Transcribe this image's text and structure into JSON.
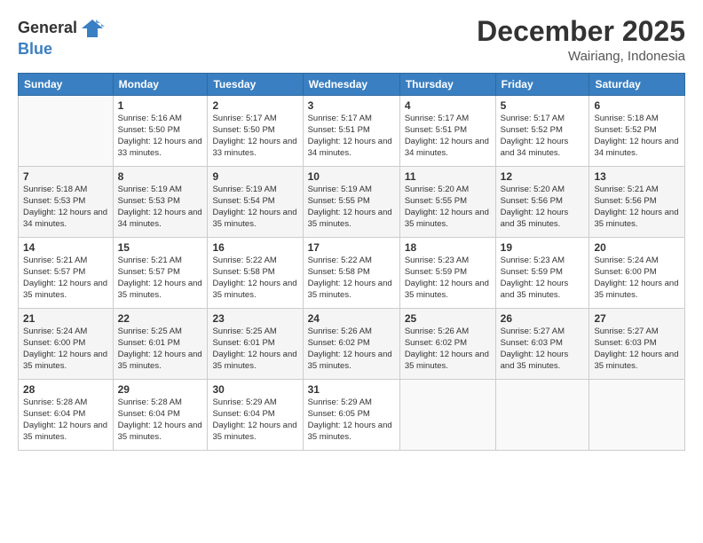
{
  "app": {
    "logo_general": "General",
    "logo_blue": "Blue"
  },
  "header": {
    "month": "December 2025",
    "location": "Wairiang, Indonesia"
  },
  "columns": [
    "Sunday",
    "Monday",
    "Tuesday",
    "Wednesday",
    "Thursday",
    "Friday",
    "Saturday"
  ],
  "weeks": [
    [
      {
        "day": "",
        "sunrise": "",
        "sunset": "",
        "daylight": ""
      },
      {
        "day": "1",
        "sunrise": "Sunrise: 5:16 AM",
        "sunset": "Sunset: 5:50 PM",
        "daylight": "Daylight: 12 hours and 33 minutes."
      },
      {
        "day": "2",
        "sunrise": "Sunrise: 5:17 AM",
        "sunset": "Sunset: 5:50 PM",
        "daylight": "Daylight: 12 hours and 33 minutes."
      },
      {
        "day": "3",
        "sunrise": "Sunrise: 5:17 AM",
        "sunset": "Sunset: 5:51 PM",
        "daylight": "Daylight: 12 hours and 34 minutes."
      },
      {
        "day": "4",
        "sunrise": "Sunrise: 5:17 AM",
        "sunset": "Sunset: 5:51 PM",
        "daylight": "Daylight: 12 hours and 34 minutes."
      },
      {
        "day": "5",
        "sunrise": "Sunrise: 5:17 AM",
        "sunset": "Sunset: 5:52 PM",
        "daylight": "Daylight: 12 hours and 34 minutes."
      },
      {
        "day": "6",
        "sunrise": "Sunrise: 5:18 AM",
        "sunset": "Sunset: 5:52 PM",
        "daylight": "Daylight: 12 hours and 34 minutes."
      }
    ],
    [
      {
        "day": "7",
        "sunrise": "Sunrise: 5:18 AM",
        "sunset": "Sunset: 5:53 PM",
        "daylight": "Daylight: 12 hours and 34 minutes."
      },
      {
        "day": "8",
        "sunrise": "Sunrise: 5:19 AM",
        "sunset": "Sunset: 5:53 PM",
        "daylight": "Daylight: 12 hours and 34 minutes."
      },
      {
        "day": "9",
        "sunrise": "Sunrise: 5:19 AM",
        "sunset": "Sunset: 5:54 PM",
        "daylight": "Daylight: 12 hours and 35 minutes."
      },
      {
        "day": "10",
        "sunrise": "Sunrise: 5:19 AM",
        "sunset": "Sunset: 5:55 PM",
        "daylight": "Daylight: 12 hours and 35 minutes."
      },
      {
        "day": "11",
        "sunrise": "Sunrise: 5:20 AM",
        "sunset": "Sunset: 5:55 PM",
        "daylight": "Daylight: 12 hours and 35 minutes."
      },
      {
        "day": "12",
        "sunrise": "Sunrise: 5:20 AM",
        "sunset": "Sunset: 5:56 PM",
        "daylight": "Daylight: 12 hours and 35 minutes."
      },
      {
        "day": "13",
        "sunrise": "Sunrise: 5:21 AM",
        "sunset": "Sunset: 5:56 PM",
        "daylight": "Daylight: 12 hours and 35 minutes."
      }
    ],
    [
      {
        "day": "14",
        "sunrise": "Sunrise: 5:21 AM",
        "sunset": "Sunset: 5:57 PM",
        "daylight": "Daylight: 12 hours and 35 minutes."
      },
      {
        "day": "15",
        "sunrise": "Sunrise: 5:21 AM",
        "sunset": "Sunset: 5:57 PM",
        "daylight": "Daylight: 12 hours and 35 minutes."
      },
      {
        "day": "16",
        "sunrise": "Sunrise: 5:22 AM",
        "sunset": "Sunset: 5:58 PM",
        "daylight": "Daylight: 12 hours and 35 minutes."
      },
      {
        "day": "17",
        "sunrise": "Sunrise: 5:22 AM",
        "sunset": "Sunset: 5:58 PM",
        "daylight": "Daylight: 12 hours and 35 minutes."
      },
      {
        "day": "18",
        "sunrise": "Sunrise: 5:23 AM",
        "sunset": "Sunset: 5:59 PM",
        "daylight": "Daylight: 12 hours and 35 minutes."
      },
      {
        "day": "19",
        "sunrise": "Sunrise: 5:23 AM",
        "sunset": "Sunset: 5:59 PM",
        "daylight": "Daylight: 12 hours and 35 minutes."
      },
      {
        "day": "20",
        "sunrise": "Sunrise: 5:24 AM",
        "sunset": "Sunset: 6:00 PM",
        "daylight": "Daylight: 12 hours and 35 minutes."
      }
    ],
    [
      {
        "day": "21",
        "sunrise": "Sunrise: 5:24 AM",
        "sunset": "Sunset: 6:00 PM",
        "daylight": "Daylight: 12 hours and 35 minutes."
      },
      {
        "day": "22",
        "sunrise": "Sunrise: 5:25 AM",
        "sunset": "Sunset: 6:01 PM",
        "daylight": "Daylight: 12 hours and 35 minutes."
      },
      {
        "day": "23",
        "sunrise": "Sunrise: 5:25 AM",
        "sunset": "Sunset: 6:01 PM",
        "daylight": "Daylight: 12 hours and 35 minutes."
      },
      {
        "day": "24",
        "sunrise": "Sunrise: 5:26 AM",
        "sunset": "Sunset: 6:02 PM",
        "daylight": "Daylight: 12 hours and 35 minutes."
      },
      {
        "day": "25",
        "sunrise": "Sunrise: 5:26 AM",
        "sunset": "Sunset: 6:02 PM",
        "daylight": "Daylight: 12 hours and 35 minutes."
      },
      {
        "day": "26",
        "sunrise": "Sunrise: 5:27 AM",
        "sunset": "Sunset: 6:03 PM",
        "daylight": "Daylight: 12 hours and 35 minutes."
      },
      {
        "day": "27",
        "sunrise": "Sunrise: 5:27 AM",
        "sunset": "Sunset: 6:03 PM",
        "daylight": "Daylight: 12 hours and 35 minutes."
      }
    ],
    [
      {
        "day": "28",
        "sunrise": "Sunrise: 5:28 AM",
        "sunset": "Sunset: 6:04 PM",
        "daylight": "Daylight: 12 hours and 35 minutes."
      },
      {
        "day": "29",
        "sunrise": "Sunrise: 5:28 AM",
        "sunset": "Sunset: 6:04 PM",
        "daylight": "Daylight: 12 hours and 35 minutes."
      },
      {
        "day": "30",
        "sunrise": "Sunrise: 5:29 AM",
        "sunset": "Sunset: 6:04 PM",
        "daylight": "Daylight: 12 hours and 35 minutes."
      },
      {
        "day": "31",
        "sunrise": "Sunrise: 5:29 AM",
        "sunset": "Sunset: 6:05 PM",
        "daylight": "Daylight: 12 hours and 35 minutes."
      },
      {
        "day": "",
        "sunrise": "",
        "sunset": "",
        "daylight": ""
      },
      {
        "day": "",
        "sunrise": "",
        "sunset": "",
        "daylight": ""
      },
      {
        "day": "",
        "sunrise": "",
        "sunset": "",
        "daylight": ""
      }
    ]
  ]
}
